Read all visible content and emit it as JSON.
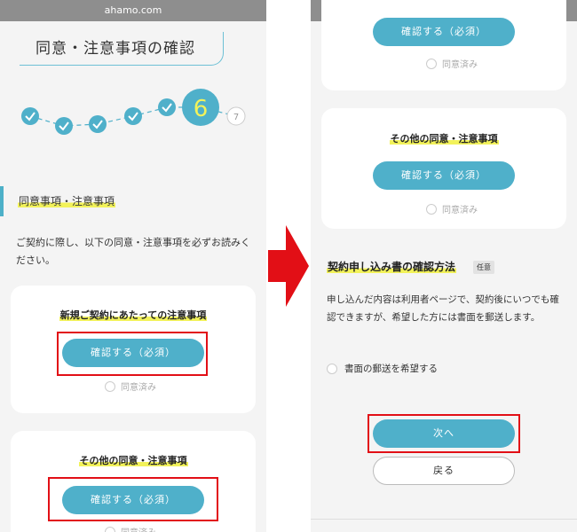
{
  "browser": {
    "url": "ahamo.com"
  },
  "left": {
    "page_title": "同意・注意事項の確認",
    "steps": {
      "current": "6",
      "next": "7",
      "completed_count": 5
    },
    "section_heading": "同意事項・注意事項",
    "intro": "ご契約に際し、以下の同意・注意事項を必ずお読みください。",
    "card1": {
      "title": "新規ご契約にあたっての注意事項",
      "button": "確認する（必須）",
      "agree": "同意済み"
    },
    "card2": {
      "title": "その他の同意・注意事項",
      "button": "確認する（必須）",
      "agree": "同意済み"
    }
  },
  "right": {
    "top_card": {
      "button": "確認する（必須）",
      "agree": "同意済み"
    },
    "card2": {
      "title": "その他の同意・注意事項",
      "button": "確認する（必須）",
      "agree": "同意済み"
    },
    "section2": {
      "title": "契約申し込み書の確認方法",
      "badge": "任意",
      "description": "申し込んだ内容は利用者ページで、契約後にいつでも確認できますが、希望した方には書面を郵送します。",
      "mail_option": "書面の郵送を希望する"
    },
    "next_button": "次へ",
    "back_button": "戻る"
  },
  "colors": {
    "accent": "#4fb0ca",
    "highlight": "#f2f25a",
    "annotation_red": "#e20f16"
  }
}
